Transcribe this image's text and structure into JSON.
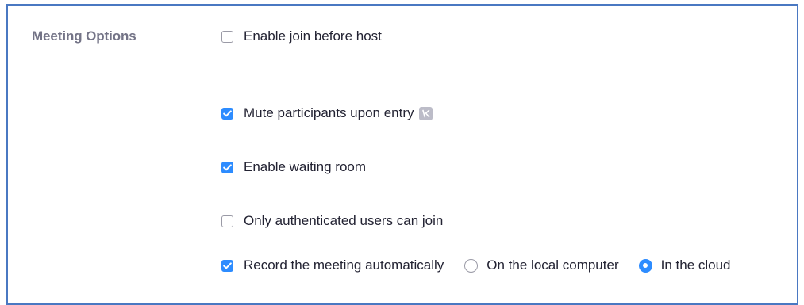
{
  "section": {
    "title": "Meeting Options"
  },
  "options": [
    {
      "label": "Enable join before host",
      "checked": false
    },
    {
      "label": "Mute participants upon entry",
      "checked": true,
      "icon": "info-icon"
    },
    {
      "label": "Enable waiting room",
      "checked": true
    },
    {
      "label": "Only authenticated users can join",
      "checked": false
    },
    {
      "label": "Record the meeting automatically",
      "checked": true
    }
  ],
  "recording": {
    "choices": [
      {
        "label": "On the local computer",
        "selected": false
      },
      {
        "label": "In the cloud",
        "selected": true
      }
    ]
  },
  "colors": {
    "accent": "#2d8cff",
    "frame_border": "#4a78c2",
    "section_title": "#747487",
    "text": "#232333",
    "unchecked_border": "#9a9aa6"
  }
}
